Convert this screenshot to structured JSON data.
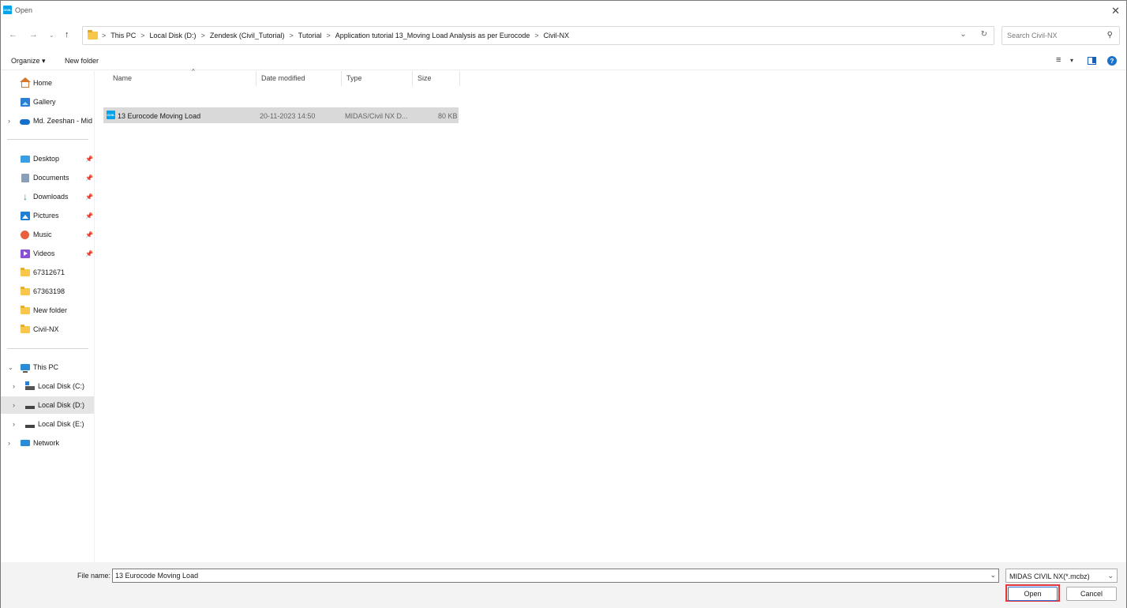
{
  "window": {
    "title": "Open",
    "app_icon_text": "CIVIL",
    "close_glyph": "✕"
  },
  "address_bar": {
    "crumbs": [
      "This PC",
      "Local Disk (D:)",
      "Zendesk (Civil_Tutorial)",
      "Tutorial",
      "Application tutorial 13_Moving Load Analysis as per Eurocode",
      "Civil-NX"
    ],
    "separator": ">"
  },
  "search": {
    "placeholder": "Search Civil-NX"
  },
  "toolbar": {
    "organize_label": "Organize ▾",
    "new_folder_label": "New folder"
  },
  "sidebar": {
    "items": [
      {
        "label": "Home",
        "icon": "home-icon"
      },
      {
        "label": "Gallery",
        "icon": "gallery-icon"
      },
      {
        "label": "Md. Zeeshan - Mid",
        "icon": "onedrive-icon"
      },
      {
        "label": "Desktop",
        "icon": "desktop-icon"
      },
      {
        "label": "Documents",
        "icon": "documents-icon"
      },
      {
        "label": "Downloads",
        "icon": "downloads-icon"
      },
      {
        "label": "Pictures",
        "icon": "pictures-icon"
      },
      {
        "label": "Music",
        "icon": "music-icon"
      },
      {
        "label": "Videos",
        "icon": "videos-icon"
      },
      {
        "label": "67312671",
        "icon": "folder-icon"
      },
      {
        "label": "67363198",
        "icon": "folder-icon"
      },
      {
        "label": "New folder",
        "icon": "folder-icon"
      },
      {
        "label": "Civil-NX",
        "icon": "folder-icon"
      },
      {
        "label": "This PC",
        "icon": "this-pc-icon"
      },
      {
        "label": "Local Disk (C:)",
        "icon": "drive-c-icon"
      },
      {
        "label": "Local Disk (D:)",
        "icon": "drive-icon"
      },
      {
        "label": "Local Disk (E:)",
        "icon": "drive-icon"
      },
      {
        "label": "Network",
        "icon": "network-icon"
      }
    ],
    "selected": "Local Disk (D:)"
  },
  "columns": [
    "Name",
    "Date modified",
    "Type",
    "Size"
  ],
  "files": [
    {
      "name": "13 Eurocode Moving Load",
      "date_modified": "20-11-2023 14:50",
      "type": "MIDAS/Civil NX D...",
      "size": "80 KB",
      "icon_text": "CIVIL"
    }
  ],
  "footer": {
    "file_name_label": "File name:",
    "file_name_value": "13 Eurocode Moving Load",
    "file_type_selected": "MIDAS CIVIL NX(*.mcbz)",
    "open_label": "Open",
    "cancel_label": "Cancel"
  },
  "colors": {
    "accent_blue": "#2f6fd8",
    "highlight_red": "#e0383e",
    "selection_gray": "#d9d9d9",
    "civil_icon_blue": "#00a2e8"
  }
}
